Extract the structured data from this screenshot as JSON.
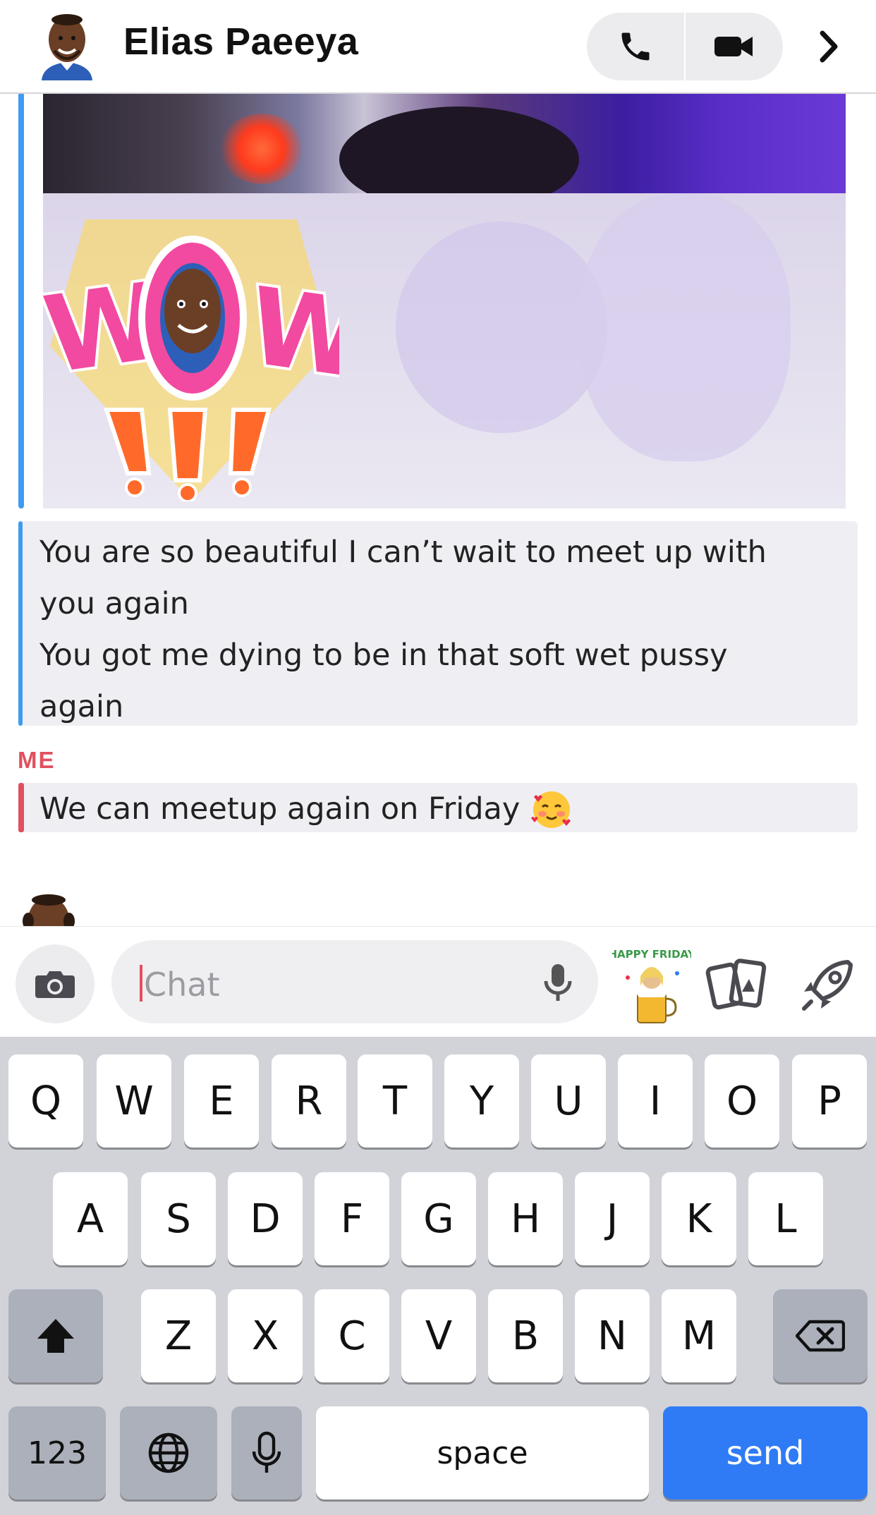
{
  "header": {
    "contact_name": "Elias Paeeya",
    "voice_call_icon": "phone-icon",
    "video_call_icon": "video-camera-icon",
    "more_icon": "chevron-right-icon"
  },
  "chat": {
    "media_message": {
      "sticker_text": "WOW!!!",
      "sender_color": "#3e9cf0"
    },
    "their_text": "You are so beautiful I can’t wait to meet up with\nyou again\nYou got me dying to be in that soft wet pussy\nagain",
    "me_label": "ME",
    "me_color": "#e0505e",
    "me_text": "We can meetup again on Friday",
    "me_emoji": "smiling-face-with-hearts-emoji"
  },
  "input_bar": {
    "placeholder": "Chat",
    "camera_icon": "camera-icon",
    "mic_icon": "microphone-icon",
    "sticker_text": "HAPPY FRIDAY",
    "cards_icon": "cards-icon",
    "games_icon": "rocket-icon"
  },
  "keyboard": {
    "row1": [
      "Q",
      "W",
      "E",
      "R",
      "T",
      "Y",
      "U",
      "I",
      "O",
      "P"
    ],
    "row2": [
      "A",
      "S",
      "D",
      "F",
      "G",
      "H",
      "J",
      "K",
      "L"
    ],
    "row3": [
      "Z",
      "X",
      "C",
      "V",
      "B",
      "N",
      "M"
    ],
    "numbers_label": "123",
    "space_label": "space",
    "send_label": "send",
    "send_color": "#2f7bf6"
  }
}
